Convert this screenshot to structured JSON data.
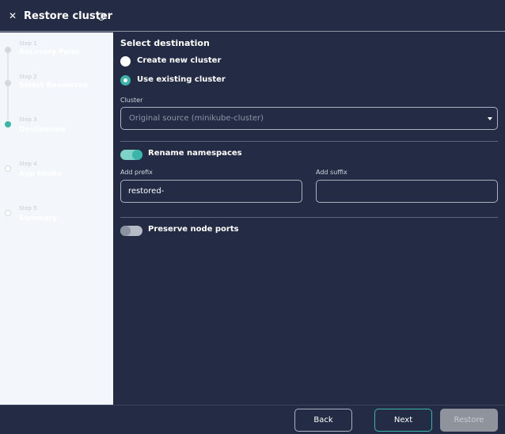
{
  "header": {
    "title": "Restore cluster",
    "close_icon": "close-icon",
    "info_icon": "info-icon"
  },
  "steps": [
    {
      "number": "Step 1",
      "label": "Recovery Point",
      "state": "done"
    },
    {
      "number": "Step 2",
      "label": "Select Resources",
      "state": "done"
    },
    {
      "number": "Step 3",
      "label": "Destination",
      "state": "active"
    },
    {
      "number": "Step 4",
      "label": "App Hooks",
      "state": "pending"
    },
    {
      "number": "Step 5",
      "label": "Summary",
      "state": "pending"
    }
  ],
  "destination": {
    "section_title": "Select destination",
    "option_new": "Create new cluster",
    "option_existing": "Use existing cluster",
    "selected": "existing",
    "cluster_label": "Cluster",
    "cluster_value": "Original source (minikube-cluster)"
  },
  "namespaces": {
    "rename_label": "Rename namespaces",
    "rename_enabled": true,
    "prefix_label": "Add prefix",
    "prefix_value": "restored-",
    "suffix_label": "Add suffix",
    "suffix_value": ""
  },
  "ports": {
    "preserve_label": "Preserve node ports",
    "preserve_enabled": false
  },
  "footer": {
    "back_label": "Back",
    "next_label": "Next",
    "restore_label": "Restore"
  },
  "colors": {
    "background": "#232c44",
    "accent": "#3ab5a7",
    "sidebar": "#f3f7fb"
  }
}
